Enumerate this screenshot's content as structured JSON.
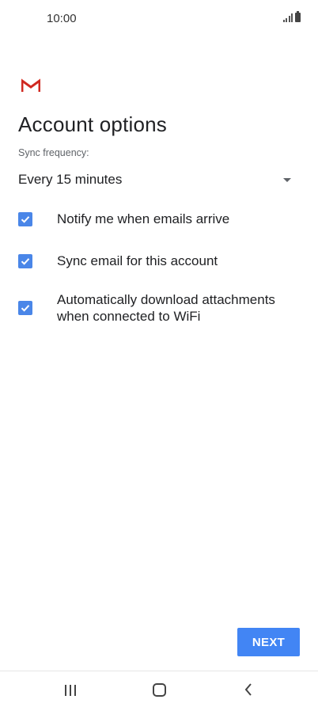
{
  "status_bar": {
    "time": "10:00"
  },
  "header": {
    "title": "Account options"
  },
  "sync": {
    "label": "Sync frequency:",
    "selected": "Every 15 minutes"
  },
  "options": [
    {
      "label": "Notify me when emails arrive",
      "checked": true
    },
    {
      "label": "Sync email for this account",
      "checked": true
    },
    {
      "label": "Automatically download attachments when connected to WiFi",
      "checked": true
    }
  ],
  "actions": {
    "next_label": "NEXT"
  },
  "colors": {
    "accent": "#4285f4",
    "checkbox": "#4a86e8",
    "gmail_red": "#d93025"
  },
  "icons": {
    "logo": "gmail-icon",
    "dropdown": "chevron-down-icon",
    "checkbox": "checkmark-icon",
    "nav": [
      "recent-apps-icon",
      "home-icon",
      "back-icon"
    ]
  }
}
